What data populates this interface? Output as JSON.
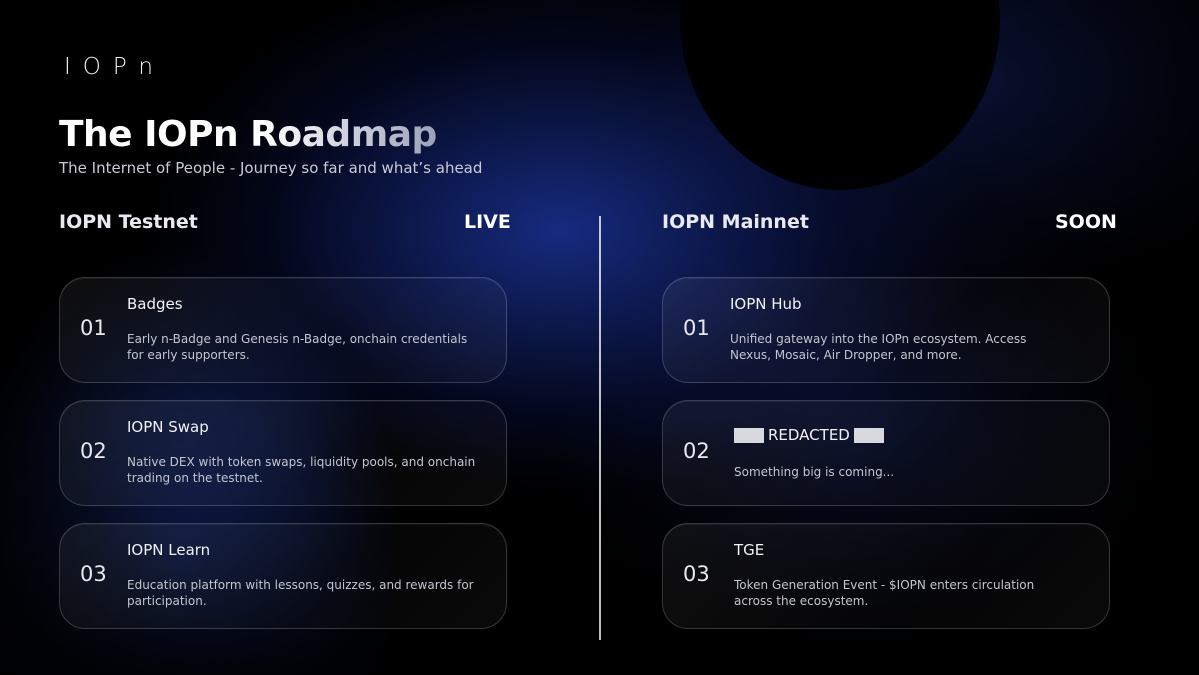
{
  "brand": {
    "logo": "IOPn"
  },
  "header": {
    "title": "The IOPn Roadmap",
    "subtitle": "The Internet of People - Journey so far and what’s ahead"
  },
  "columns": [
    {
      "heading": "IOPN Testnet",
      "status": "LIVE",
      "items": [
        {
          "num": "01",
          "title": "Badges",
          "desc": "Early n-Badge and Genesis n-Badge, onchain credentials for early supporters."
        },
        {
          "num": "02",
          "title": "IOPN Swap",
          "desc": "Native DEX with token swaps, liquidity pools, and onchain trading on the testnet."
        },
        {
          "num": "03",
          "title": "IOPN Learn",
          "desc": "Education platform with lessons, quizzes, and rewards for participation."
        }
      ]
    },
    {
      "heading": "IOPN Mainnet",
      "status": "SOON",
      "items": [
        {
          "num": "01",
          "title": "IOPN Hub",
          "desc": "Unified gateway into the IOPn ecosystem. Access Nexus, Mosaic, Air Dropper, and more."
        },
        {
          "num": "02",
          "title": "REDACTED",
          "desc": "Something big is coming..."
        },
        {
          "num": "03",
          "title": "TGE",
          "desc": "Token Generation Event - $IOPN enters circulation across the ecosystem."
        }
      ]
    }
  ]
}
